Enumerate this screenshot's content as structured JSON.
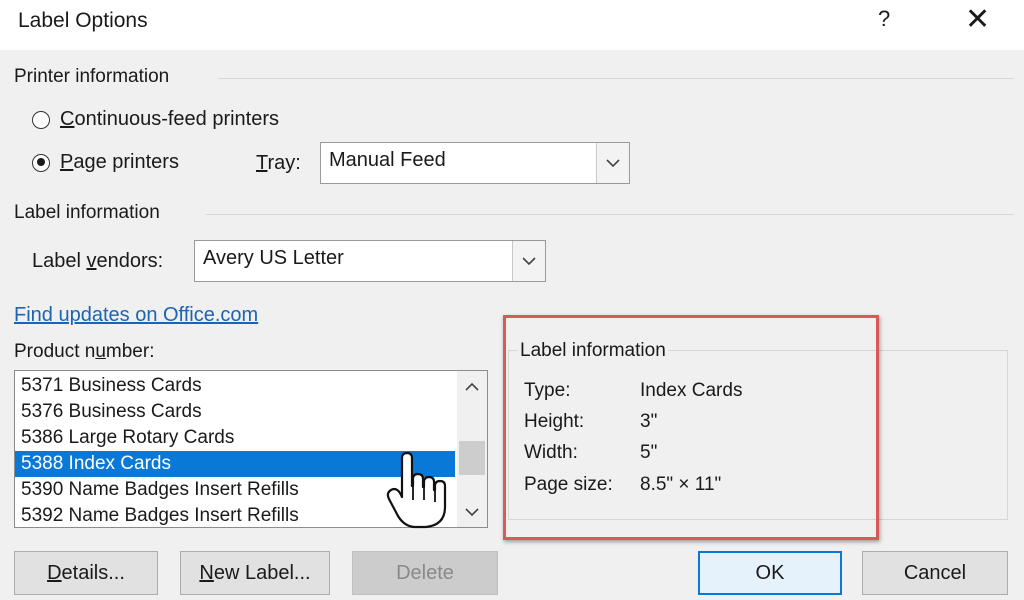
{
  "window": {
    "title": "Label Options",
    "help_icon": "?",
    "close_icon": "✕"
  },
  "printer_info": {
    "group_label": "Printer information",
    "continuous_feed_prefix": "",
    "continuous_feed_mnemonic": "C",
    "continuous_feed_rest": "ontinuous-feed printers",
    "continuous_feed_checked": false,
    "page_printers_prefix": "",
    "page_printers_mnemonic": "P",
    "page_printers_rest": "age printers",
    "page_printers_checked": true,
    "tray_mnemonic": "T",
    "tray_rest": "ray:",
    "tray_value": "Manual Feed"
  },
  "label_info": {
    "group_label": "Label information",
    "vendors_prefix": "Label ",
    "vendors_mnemonic": "v",
    "vendors_rest": "endors:",
    "vendors_value": "Avery US Letter"
  },
  "find_updates_link": "Find updates on Office.com",
  "product": {
    "label_prefix": "Product n",
    "label_mnemonic": "u",
    "label_rest": "mber:",
    "items": [
      "5371 Business Cards",
      "5376 Business Cards",
      "5386 Large Rotary Cards",
      "5388 Index Cards",
      "5390 Name Badges Insert Refills",
      "5392 Name Badges Insert Refills"
    ],
    "selected_index": 3
  },
  "details_panel": {
    "title": "Label information",
    "type_key": "Type:",
    "type_value": "Index Cards",
    "height_key": "Height:",
    "height_value": "3\"",
    "width_key": "Width:",
    "width_value": "5\"",
    "page_size_key": "Page size:",
    "page_size_value": "8.5\" × 11\""
  },
  "buttons": {
    "details_mnemonic": "D",
    "details_rest": "etails...",
    "new_label_mnemonic": "N",
    "new_label_rest": "ew Label...",
    "delete": "Delete",
    "ok": "OK",
    "cancel": "Cancel"
  },
  "colors": {
    "highlight": "#d9595a",
    "selection": "#0a78d7",
    "link": "#1a64b4"
  },
  "icons": {
    "scroll_up": "chevron-up-icon",
    "scroll_down": "chevron-down-icon",
    "cursor": "hand-pointer-icon"
  }
}
